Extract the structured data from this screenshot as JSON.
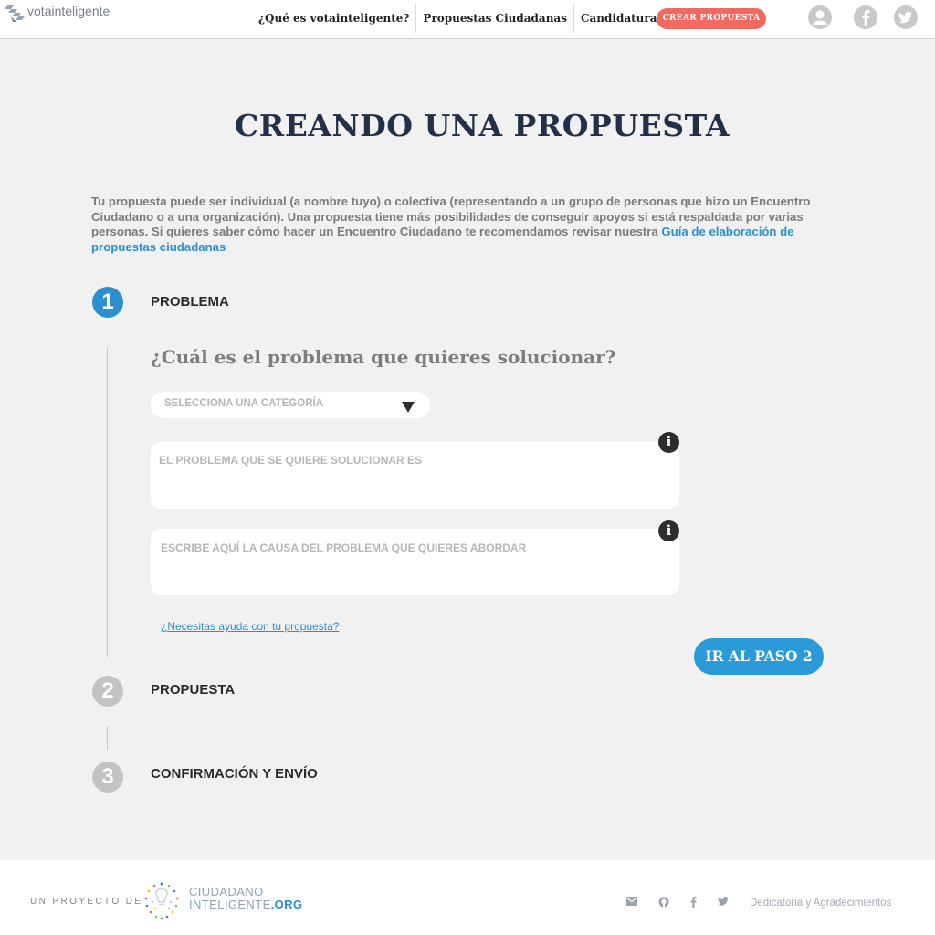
{
  "header": {
    "logo_text": "votainteligente",
    "nav": [
      {
        "label": "¿Qué es votainteligente?"
      },
      {
        "label": "Propuestas Ciudadanas"
      },
      {
        "label": "Candidaturas"
      }
    ],
    "cta_label": "CREAR PROPUESTA",
    "icons": [
      "user-icon",
      "facebook-icon",
      "twitter-icon"
    ]
  },
  "main": {
    "title": "CREANDO UNA PROPUESTA",
    "intro_text": "Tu propuesta puede ser individual (a nombre tuyo) o colectiva (representando a un grupo de personas que hizo un Encuentro Ciudadano o a una organización). Una propuesta tiene más posibilidades de conseguir apoyos si está respaldada por varias personas. Si quieres saber cómo hacer un Encuentro Ciudadano te recomendamos revisar nuestra ",
    "intro_link": "Guía de elaboración de propuestas ciudadanas",
    "steps": [
      {
        "number": "1",
        "label": "PROBLEMA",
        "state": "active"
      },
      {
        "number": "2",
        "label": "PROPUESTA",
        "state": "inactive"
      },
      {
        "number": "3",
        "label": "CONFIRMACIÓN Y ENVÍO",
        "state": "inactive"
      }
    ],
    "question": "¿Cuál es el problema que quieres solucionar?",
    "category_select": {
      "placeholder": "SELECCIONA UNA CATEGORÍA"
    },
    "problem_field": {
      "placeholder": "EL PROBLEMA QUE SE QUIERE SOLUCIONAR ES"
    },
    "cause_field": {
      "placeholder": "ESCRIBE AQUÍ LA CAUSA DEL PROBLEMA QUE QUIERES ABORDAR"
    },
    "info_glyph": "i",
    "help_link": "¿Necesitas ayuda con tu propuesta?",
    "next_button": "IR AL PASO 2"
  },
  "footer": {
    "proyecto_label": "UN PROYECTO DE",
    "org_line1": "CIUDADANO",
    "org_line2": "INTELIGENTE",
    "org_suffix": ".ORG",
    "icons": [
      "email-icon",
      "github-icon",
      "facebook-icon",
      "twitter-icon"
    ],
    "link": "Dedicatoria y Agradecimientos"
  },
  "colors": {
    "accent_blue": "#2b8fd0",
    "cta_red": "#f26a5f",
    "title_navy": "#22304a",
    "background": "#f1f1f1"
  }
}
